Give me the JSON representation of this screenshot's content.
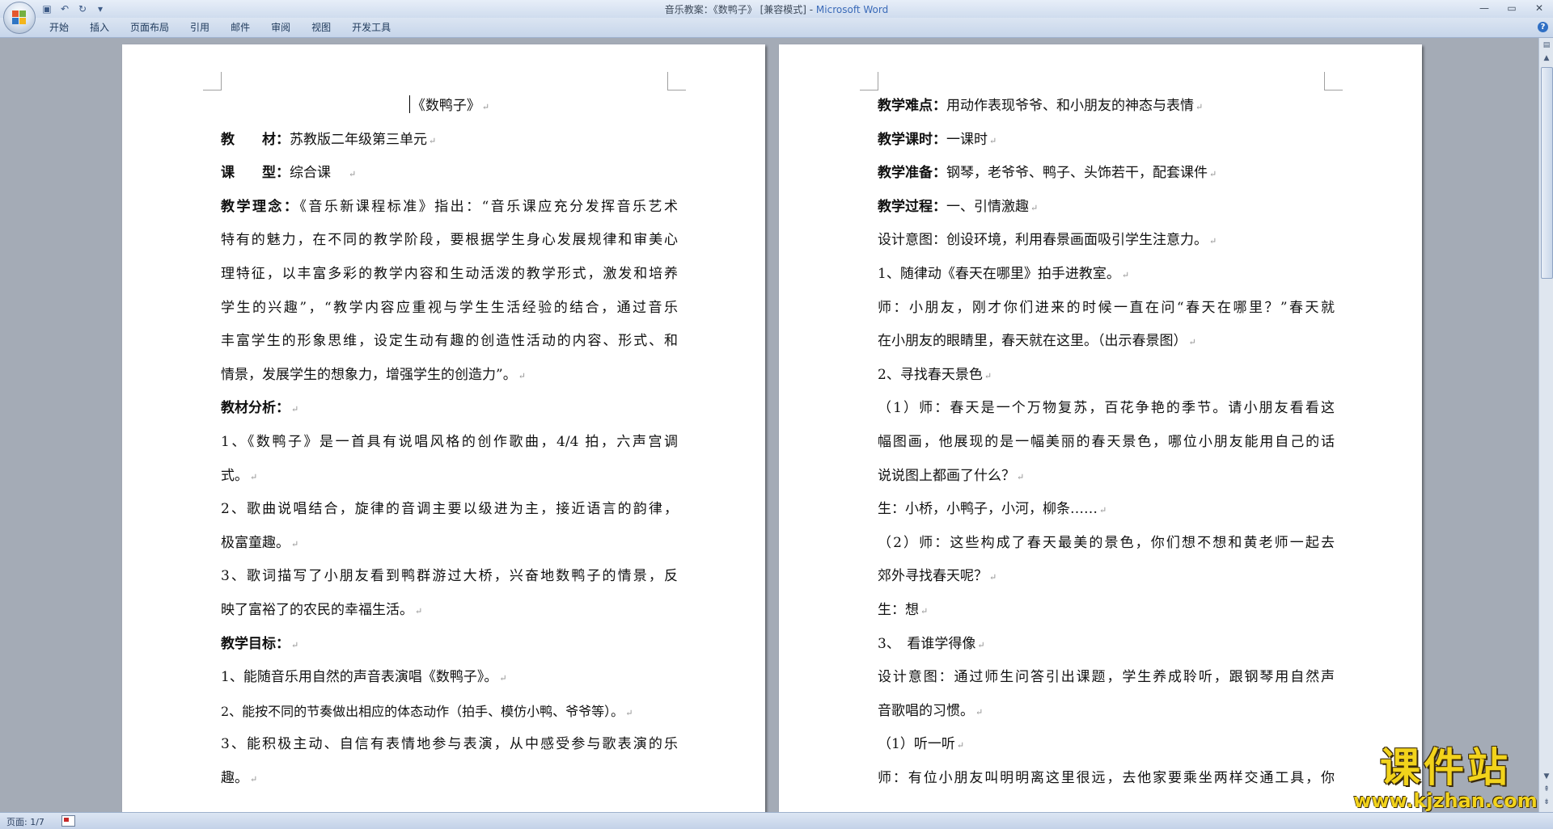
{
  "window": {
    "title_doc": "音乐教案：《数鸭子》 [兼容模式] - ",
    "title_app": "Microsoft Word",
    "minimize": "—",
    "maximize": "▭",
    "close": "✕"
  },
  "qat": {
    "save_icon": "▣",
    "undo_icon": "↶",
    "redo_icon": "↻",
    "more_icon": "▾"
  },
  "ribbon": {
    "tabs": [
      {
        "label": "开始"
      },
      {
        "label": "插入"
      },
      {
        "label": "页面布局"
      },
      {
        "label": "引用"
      },
      {
        "label": "邮件"
      },
      {
        "label": "审阅"
      },
      {
        "label": "视图"
      },
      {
        "label": "开发工具"
      }
    ],
    "help": "?"
  },
  "left_page": {
    "title": "《数鸭子》",
    "material_label": "教　　材：",
    "material": "苏教版二年级第三单元",
    "type_label": "课　　型：",
    "type": "综合课",
    "concept_label": "教学理念：",
    "concept_lines": [
      "《音乐新课程标准》指出：“音乐课应充分发挥音乐艺术",
      "特有的魅力，在不同的教学阶段，要根据学生身心发展规律和审美心",
      "理特征，以丰富多彩的教学内容和生动活泼的教学形式，激发和培养",
      "学生的兴趣”，“教学内容应重视与学生生活经验的结合，通过音乐",
      "丰富学生的形象思维，设定生动有趣的创造性活动的内容、形式、和",
      "情景，发展学生的想象力，增强学生的创造力”。"
    ],
    "analysis_label": "教材分析：",
    "analysis_lines": [
      "1、《数鸭子》是一首具有说唱风格的创作歌曲，4/4 拍，六声宫调",
      "式。",
      "2、歌曲说唱结合，旋律的音调主要以级进为主，接近语言的韵律，",
      "极富童趣。",
      "3、歌词描写了小朋友看到鸭群游过大桥，兴奋地数鸭子的情景，反",
      "映了富裕了的农民的幸福生活。"
    ],
    "goals_label": "教学目标：",
    "goals_lines": [
      "1、能随音乐用自然的声音表演唱《数鸭子》。",
      "2、能按不同的节奏做出相应的体态动作（拍手、模仿小鸭、爷爷等）。",
      "3、能积极主动、自信有表情地参与表演，从中感受参与歌表演的乐",
      "趣。"
    ]
  },
  "right_page": {
    "difficulty_label": "教学难点：",
    "difficulty": "用动作表现爷爷、和小朋友的神态与表情",
    "hours_label": "教学课时：",
    "hours": "一课时",
    "prep_label": "教学准备：",
    "prep": "钢琴，老爷爷、鸭子、头饰若干，配套课件",
    "process_label": "教学过程：",
    "process": "一、引情激趣",
    "lines": [
      "设计意图：创设环境，利用春景画面吸引学生注意力。",
      "1、随律动《春天在哪里》拍手进教室。",
      "师：小朋友，刚才你们进来的时候一直在问“春天在哪里？”春天就",
      "在小朋友的眼睛里，春天就在这里。（出示春景图）",
      "2、寻找春天景色",
      "（1）师：春天是一个万物复苏，百花争艳的季节。请小朋友看看这",
      "幅图画，他展现的是一幅美丽的春天景色，哪位小朋友能用自己的话",
      "说说图上都画了什么？",
      "生：小桥，小鸭子，小河，柳条……",
      "（2）师：这些构成了春天最美的景色，你们想不想和黄老师一起去",
      "郊外寻找春天呢？",
      "生：想",
      "3、　看谁学得像",
      "设计意图：通过师生问答引出课题，学生养成聆听，跟钢琴用自然声",
      "音歌唱的习惯。",
      "（1）听一听",
      "师：有位小朋友叫明明离这里很远，去他家要乘坐两样交通工具，你"
    ]
  },
  "paragraph_mark": "↵",
  "status": {
    "page": "页面: 1/7"
  },
  "watermark": {
    "title": "课件站",
    "url": "www.kjzhan.com"
  }
}
